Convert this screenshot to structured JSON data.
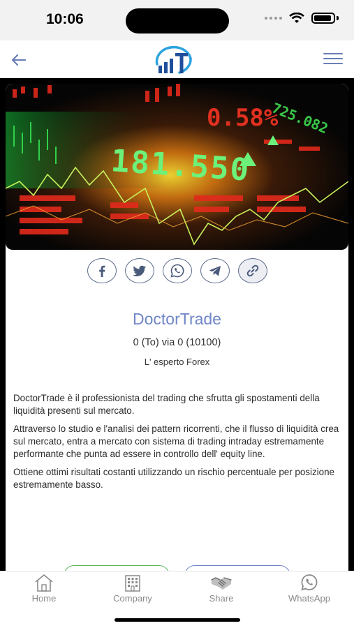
{
  "status": {
    "time": "10:06"
  },
  "profile": {
    "name": "DoctorTrade",
    "stats": "0 (To) via 0 (10100)",
    "subtitle": "L' esperto Forex",
    "description": [
      "DoctorTrade è il professionista del trading che sfrutta gli spostamenti della liquidità presenti sul mercato.",
      "Attraverso lo studio e l'analisi dei pattern ricorrenti, che il flusso di liquidità crea sul mercato, entra a mercato con sistema di trading intraday estremamente performante che punta ad essere in controllo dell' equity line.",
      "Ottiene ottimi risultati costanti utilizzando un rischio percentuale per posizione estremamente basso."
    ]
  },
  "hero": {
    "tickers": [
      "181.550",
      "0.58%",
      "725.082"
    ]
  },
  "share": [
    "facebook-icon",
    "twitter-icon",
    "whatsapp-icon",
    "telegram-icon",
    "link-icon"
  ],
  "tabs": [
    {
      "label": "Home",
      "icon": "home-icon"
    },
    {
      "label": "Company",
      "icon": "building-icon"
    },
    {
      "label": "Share",
      "icon": "handshake-icon"
    },
    {
      "label": "WhatsApp",
      "icon": "whatsapp-icon"
    }
  ],
  "colors": {
    "accent": "#6f86c9",
    "green_button": "#5cb85c",
    "tab_label": "#8a8a8a"
  }
}
